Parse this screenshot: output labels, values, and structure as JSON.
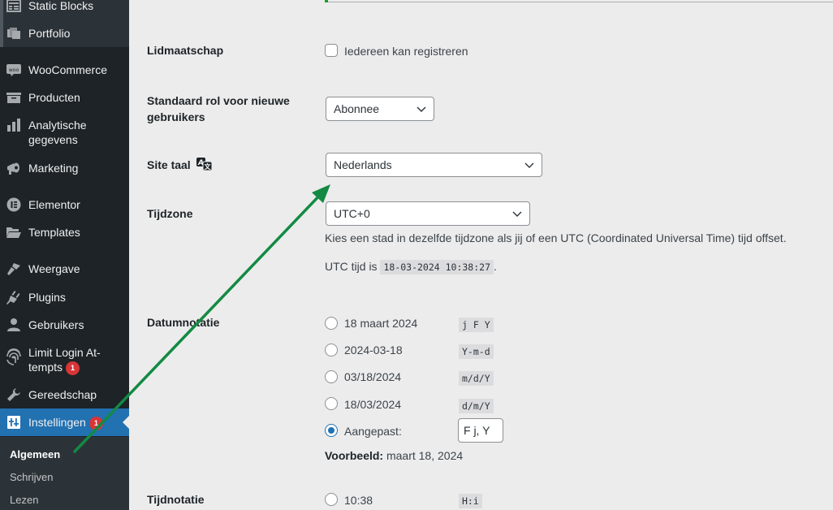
{
  "sidebar": {
    "items": [
      {
        "label": "Static Blocks",
        "icon": "table-icon"
      },
      {
        "label": "Portfolio",
        "icon": "portfolio-icon"
      },
      {
        "label": "WooCommerce",
        "icon": "woo-icon"
      },
      {
        "label": "Producten",
        "icon": "archive-icon"
      },
      {
        "label": "Analytische gegevens",
        "line1": "Analytische",
        "line2": "gegevens",
        "icon": "bar-chart-icon"
      },
      {
        "label": "Marketing",
        "icon": "megaphone-icon"
      },
      {
        "label": "Elementor",
        "icon": "elementor-icon"
      },
      {
        "label": "Templates",
        "icon": "folder-icon"
      },
      {
        "label": "Weergave",
        "icon": "paintbrush-icon"
      },
      {
        "label": "Plugins",
        "icon": "plug-icon"
      },
      {
        "label": "Gebruikers",
        "icon": "user-icon"
      },
      {
        "label": "Limit Login Attempts",
        "line1": "Limit Login At-",
        "line2": "tempts",
        "badge": "1",
        "icon": "fingerprint-icon"
      },
      {
        "label": "Gereedschap",
        "icon": "wrench-icon"
      },
      {
        "label": "Instellingen",
        "badge": "1",
        "icon": "settings-icon",
        "current": true
      }
    ],
    "submenu": [
      {
        "label": "Algemeen",
        "active": true
      },
      {
        "label": "Schrijven"
      },
      {
        "label": "Lezen"
      }
    ]
  },
  "settings": {
    "membership": {
      "label": "Lidmaatschap",
      "checkbox_label": "Iedereen kan registreren",
      "checked": false
    },
    "default_role": {
      "label_line1": "Standaard rol voor nieuwe",
      "label_line2": "gebruikers",
      "value": "Abonnee"
    },
    "site_language": {
      "label": "Site taal",
      "icon": "translation-icon",
      "value": "Nederlands"
    },
    "timezone": {
      "label": "Tijdzone",
      "value": "UTC+0",
      "description": "Kies een stad in dezelfde tijdzone als jij of een UTC (Coordinated Universal Time) tijd offset.",
      "utc_prefix": "UTC tijd is",
      "utc_time": "18-03-2024 10:38:27",
      "utc_suffix": "."
    },
    "date_format": {
      "label": "Datumnotatie",
      "options": [
        {
          "label": "18 maart 2024",
          "code": "j F Y",
          "checked": false
        },
        {
          "label": "2024-03-18",
          "code": "Y-m-d",
          "checked": false
        },
        {
          "label": "03/18/2024",
          "code": "m/d/Y",
          "checked": false
        },
        {
          "label": "18/03/2024",
          "code": "d/m/Y",
          "checked": false
        },
        {
          "label": "Aangepast:",
          "checked": true
        }
      ],
      "custom_value": "F j, Y",
      "preview_label": "Voorbeeld:",
      "preview_value": "maart 18, 2024"
    },
    "time_format": {
      "label": "Tijdnotatie",
      "options": [
        {
          "label": "10:38",
          "code": "H:i",
          "checked": false
        }
      ]
    }
  },
  "colors": {
    "sidebar_bg": "#1d2327",
    "accent": "#2271b1",
    "badge": "#d63638",
    "annotation_arrow": "#138a43"
  }
}
